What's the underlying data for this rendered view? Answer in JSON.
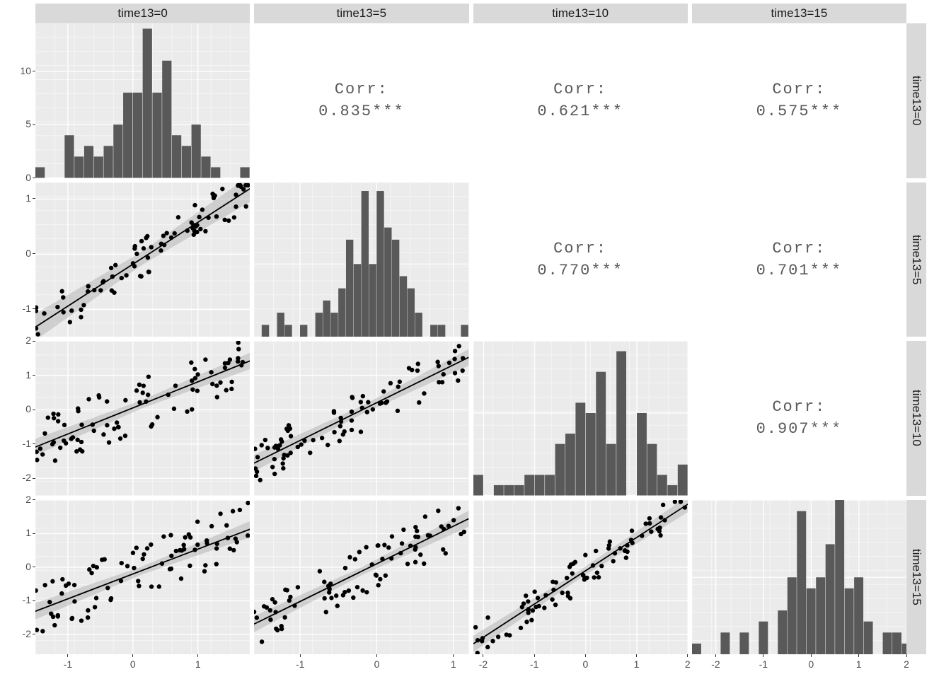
{
  "chart_data": {
    "type": "pairs_matrix",
    "variables": [
      "time13=0",
      "time13=5",
      "time13=10",
      "time13=15"
    ],
    "correlations": {
      "r0c1": "0.835***",
      "r0c2": "0.621***",
      "r0c3": "0.575***",
      "r1c2": "0.770***",
      "r1c3": "0.701***",
      "r2c3": "0.907***"
    },
    "corr_label": "Corr:",
    "axis_ranges": {
      "col0_x": [
        -1.5,
        1.8
      ],
      "col1_x": [
        -1.6,
        1.2
      ],
      "col2_x": [
        -2.2,
        2.0
      ],
      "col3_x": [
        -2.5,
        2.0
      ],
      "row1_y": [
        -1.5,
        1.3
      ],
      "row2_y": [
        -2.5,
        2.0
      ],
      "row3_y": [
        -2.6,
        2.0
      ]
    },
    "x_ticks": {
      "col0": [
        -1,
        0,
        1
      ],
      "col1": [
        -1,
        0,
        1
      ],
      "col2": [
        -2,
        -1,
        0,
        1,
        2
      ],
      "col3": [
        -2,
        -1,
        0,
        1,
        2
      ]
    },
    "y_ticks": {
      "row0": [
        0,
        5,
        10
      ],
      "row1": [
        -1,
        0,
        1
      ],
      "row2": [
        -2,
        -1,
        0,
        1,
        2
      ],
      "row3": [
        -2,
        -1,
        0,
        1,
        2
      ]
    },
    "histograms": {
      "diag0": {
        "x_range": [
          -1.5,
          1.8
        ],
        "y_range": [
          0,
          14.5
        ],
        "bins": [
          [
            -1.5,
            1
          ],
          [
            -1.35,
            0
          ],
          [
            -1.2,
            0
          ],
          [
            -1.05,
            4
          ],
          [
            -0.9,
            2
          ],
          [
            -0.75,
            3
          ],
          [
            -0.6,
            2
          ],
          [
            -0.45,
            3
          ],
          [
            -0.3,
            5
          ],
          [
            -0.15,
            8
          ],
          [
            0,
            8
          ],
          [
            0.15,
            14
          ],
          [
            0.3,
            8
          ],
          [
            0.45,
            11
          ],
          [
            0.6,
            4
          ],
          [
            0.75,
            3
          ],
          [
            0.9,
            5
          ],
          [
            1.05,
            2
          ],
          [
            1.2,
            1
          ],
          [
            1.35,
            0
          ],
          [
            1.5,
            0
          ],
          [
            1.65,
            1
          ]
        ]
      },
      "diag1": {
        "x_range": [
          -1.6,
          1.2
        ],
        "y_range": [
          0,
          12.7
        ],
        "bins": [
          [
            -1.5,
            1
          ],
          [
            -1.4,
            0
          ],
          [
            -1.3,
            2
          ],
          [
            -1.2,
            1
          ],
          [
            -1.1,
            0
          ],
          [
            -1.0,
            1
          ],
          [
            -0.9,
            0
          ],
          [
            -0.8,
            2
          ],
          [
            -0.7,
            3
          ],
          [
            -0.6,
            2
          ],
          [
            -0.5,
            4
          ],
          [
            -0.4,
            8
          ],
          [
            -0.3,
            6
          ],
          [
            -0.2,
            12
          ],
          [
            -0.1,
            6
          ],
          [
            0.0,
            12
          ],
          [
            0.1,
            9
          ],
          [
            0.2,
            8
          ],
          [
            0.3,
            5
          ],
          [
            0.4,
            4
          ],
          [
            0.5,
            2
          ],
          [
            0.6,
            0
          ],
          [
            0.7,
            1
          ],
          [
            0.8,
            1
          ],
          [
            0.9,
            0
          ],
          [
            1.0,
            0
          ],
          [
            1.1,
            1
          ]
        ]
      },
      "diag2": {
        "x_range": [
          -2.2,
          2.0
        ],
        "y_range": [
          0,
          15
        ],
        "bins": [
          [
            -2.2,
            2
          ],
          [
            -2.0,
            0
          ],
          [
            -1.8,
            1
          ],
          [
            -1.6,
            1
          ],
          [
            -1.4,
            1
          ],
          [
            -1.2,
            2
          ],
          [
            -1.0,
            2
          ],
          [
            -0.8,
            2
          ],
          [
            -0.6,
            5
          ],
          [
            -0.4,
            6
          ],
          [
            -0.2,
            9
          ],
          [
            0.0,
            8
          ],
          [
            0.2,
            12
          ],
          [
            0.4,
            5
          ],
          [
            0.6,
            14
          ],
          [
            0.8,
            0
          ],
          [
            1.0,
            8
          ],
          [
            1.2,
            5
          ],
          [
            1.4,
            2
          ],
          [
            1.6,
            1
          ],
          [
            1.8,
            3
          ]
        ]
      },
      "diag3": {
        "x_range": [
          -2.5,
          2.0
        ],
        "y_range": [
          0,
          14
        ],
        "bins": [
          [
            -2.5,
            1
          ],
          [
            -2.3,
            0
          ],
          [
            -2.1,
            0
          ],
          [
            -1.9,
            2
          ],
          [
            -1.7,
            0
          ],
          [
            -1.5,
            2
          ],
          [
            -1.3,
            0
          ],
          [
            -1.1,
            3
          ],
          [
            -0.9,
            0
          ],
          [
            -0.7,
            4
          ],
          [
            -0.5,
            7
          ],
          [
            -0.3,
            13
          ],
          [
            -0.1,
            6
          ],
          [
            0.1,
            7
          ],
          [
            0.3,
            10
          ],
          [
            0.5,
            14
          ],
          [
            0.7,
            6
          ],
          [
            0.9,
            7
          ],
          [
            1.1,
            3
          ],
          [
            1.3,
            0
          ],
          [
            1.5,
            2
          ],
          [
            1.7,
            2
          ],
          [
            1.9,
            1
          ]
        ]
      }
    },
    "regressions": {
      "r1c0": {
        "slope": 0.76,
        "intercept": -0.18
      },
      "r2c0": {
        "slope": 0.76,
        "intercept": 0.05
      },
      "r2c1": {
        "slope": 1.1,
        "intercept": 0.2
      },
      "r3c0": {
        "slope": 0.74,
        "intercept": -0.2
      },
      "r3c1": {
        "slope": 1.12,
        "intercept": 0.1
      },
      "r3c2": {
        "slope": 0.99,
        "intercept": -0.1
      }
    }
  },
  "layout": {
    "left_margin": 50,
    "top_margin": 5,
    "right_margin": 35,
    "bottom_margin": 35,
    "strip_h": 28,
    "strip_w": 28,
    "gap": 6
  }
}
